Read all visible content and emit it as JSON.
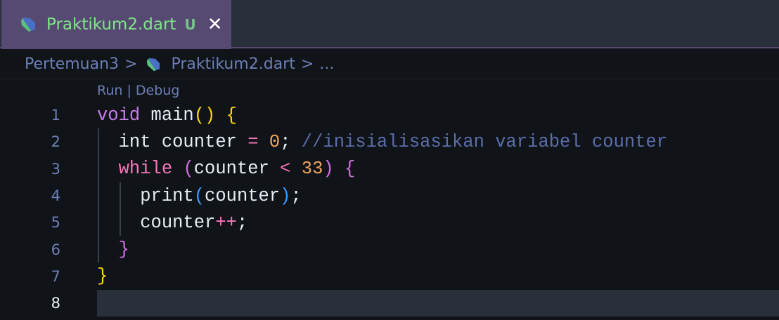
{
  "tab": {
    "title": "Praktikum2.dart",
    "status": "U",
    "close": "✕"
  },
  "breadcrumb": {
    "folder": "Pertemuan3",
    "file": "Praktikum2.dart",
    "more": "...",
    "separator": ">"
  },
  "codelens": {
    "run": "Run",
    "sep": " | ",
    "debug": "Debug"
  },
  "colors": {
    "keyword": "#f778ba",
    "type": "#d58bf0",
    "number": "#f2a65a",
    "comment": "#5a6eaa",
    "bracket_yellow": "#ffd700",
    "bracket_purple": "#d070e0",
    "bracket_blue": "#3b9cff",
    "text": "#e6edf3"
  },
  "code": [
    {
      "num": "1",
      "tokens": [
        [
          "void",
          "#c77dea"
        ],
        [
          " main",
          ""
        ],
        [
          "()",
          "#ffd700"
        ],
        [
          " ",
          ""
        ],
        [
          "{",
          "#ffd700"
        ]
      ]
    },
    {
      "num": "2",
      "tokens": [
        [
          "  int counter ",
          ""
        ],
        [
          "=",
          "#f778ba"
        ],
        [
          " ",
          ""
        ],
        [
          "0",
          "#f2a65a"
        ],
        [
          "; ",
          ""
        ],
        [
          "//inisialisasikan variabel counter",
          "#5a6eaa"
        ]
      ]
    },
    {
      "num": "3",
      "tokens": [
        [
          "  ",
          ""
        ],
        [
          "while",
          "#f778ba"
        ],
        [
          " ",
          ""
        ],
        [
          "(",
          "#d070e0"
        ],
        [
          "counter ",
          ""
        ],
        [
          "<",
          "#f778ba"
        ],
        [
          " ",
          ""
        ],
        [
          "33",
          "#f2a65a"
        ],
        [
          ")",
          "#d070e0"
        ],
        [
          " ",
          ""
        ],
        [
          "{",
          "#d070e0"
        ]
      ]
    },
    {
      "num": "4",
      "tokens": [
        [
          "    print",
          ""
        ],
        [
          "(",
          "#3b9cff"
        ],
        [
          "counter",
          ""
        ],
        [
          ")",
          "#3b9cff"
        ],
        [
          ";",
          ""
        ]
      ]
    },
    {
      "num": "5",
      "tokens": [
        [
          "    counter",
          ""
        ],
        [
          "++",
          "#f778ba"
        ],
        [
          ";",
          ""
        ]
      ]
    },
    {
      "num": "6",
      "tokens": [
        [
          "  ",
          ""
        ],
        [
          "}",
          "#d070e0"
        ]
      ]
    },
    {
      "num": "7",
      "tokens": [
        [
          "}",
          "#ffd700"
        ]
      ]
    },
    {
      "num": "8",
      "tokens": []
    }
  ]
}
